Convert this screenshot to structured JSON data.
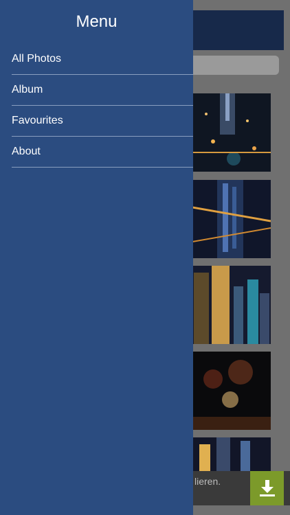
{
  "drawer": {
    "title": "Menu",
    "items": [
      {
        "label": "All Photos"
      },
      {
        "label": "Album"
      },
      {
        "label": "Favourites"
      },
      {
        "label": "About"
      }
    ]
  },
  "ad_banner": {
    "text": "lieren.",
    "download_icon": "download-icon"
  },
  "colors": {
    "drawer_bg": "#2b4c80",
    "header_bg": "#17294a",
    "ad_button": "#7c9a2a"
  }
}
